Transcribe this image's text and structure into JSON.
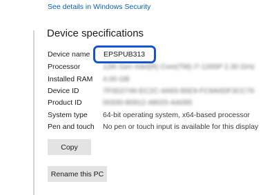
{
  "header": {
    "security_link": "See details in Windows Security"
  },
  "section": {
    "title": "Device specifications"
  },
  "specs": [
    {
      "label": "Device name",
      "value": "EPSPUB313",
      "blurred": false,
      "highlighted": true
    },
    {
      "label": "Processor",
      "value": "12th Gen Intel(R) Core(TM) i7-1265P   2.30 GHz",
      "blurred": true
    },
    {
      "label": "Installed RAM",
      "value": "4.00 GB",
      "blurred": true
    },
    {
      "label": "Device ID",
      "value": "7F0D2746-EC2C-4A93-95E9-FC8A0DF3CC76",
      "blurred": true
    },
    {
      "label": "Product ID",
      "value": "00330-80912-48025-AA095",
      "blurred": true
    },
    {
      "label": "System type",
      "value": "64-bit operating system, x64-based processor",
      "blurred": false
    },
    {
      "label": "Pen and touch",
      "value": "No pen or touch input is available for this display",
      "blurred": false
    }
  ],
  "buttons": {
    "copy": "Copy",
    "rename": "Rename this PC"
  },
  "colors": {
    "link": "#0a5fb4",
    "highlight_border": "#1652d6",
    "button_bg": "#e3e3e3"
  }
}
